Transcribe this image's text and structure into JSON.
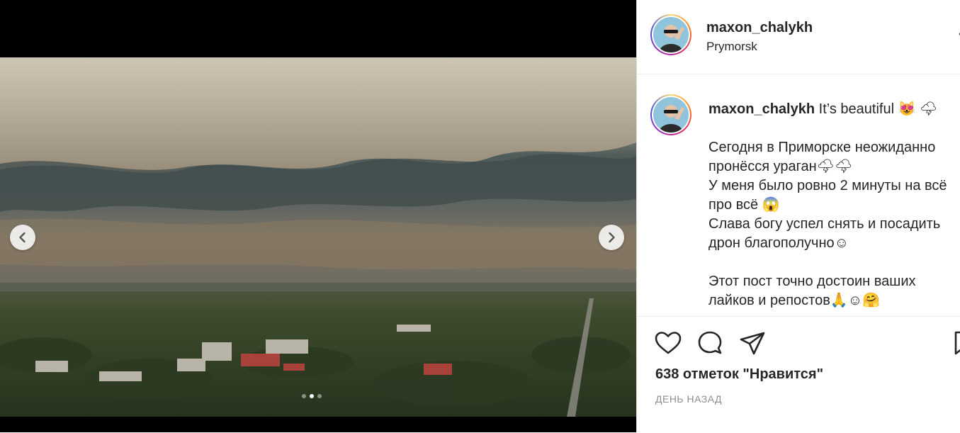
{
  "post": {
    "username": "maxon_chalykh",
    "location": "Prymorsk",
    "caption_intro": "It’s beautiful 😻 🌩",
    "caption_lines": [
      "Сегодня в Приморске неожиданно",
      "пронёсся ураган🌩🌩",
      "У меня было ровно 2 минуты на всё",
      "про всё 😱",
      "Слава богу успел снять и посадить",
      "дрон благополучно☺",
      "",
      "Этот пост точно достоин ваших",
      "лайков и репостов🙏☺🤗"
    ],
    "likes": "638 отметок \"Нравится\"",
    "time": "ДЕНЬ НАЗАД"
  },
  "carousel": {
    "slide_count": 3,
    "active_slide": 2
  },
  "icons": {
    "prev": "chevron-left-icon",
    "next": "chevron-right-icon",
    "like": "heart-icon",
    "comment": "comment-icon",
    "share": "paper-plane-icon",
    "save": "bookmark-icon"
  },
  "colors": {
    "text": "#262626",
    "muted": "#8e8e8e",
    "border": "#dbdbdb"
  }
}
